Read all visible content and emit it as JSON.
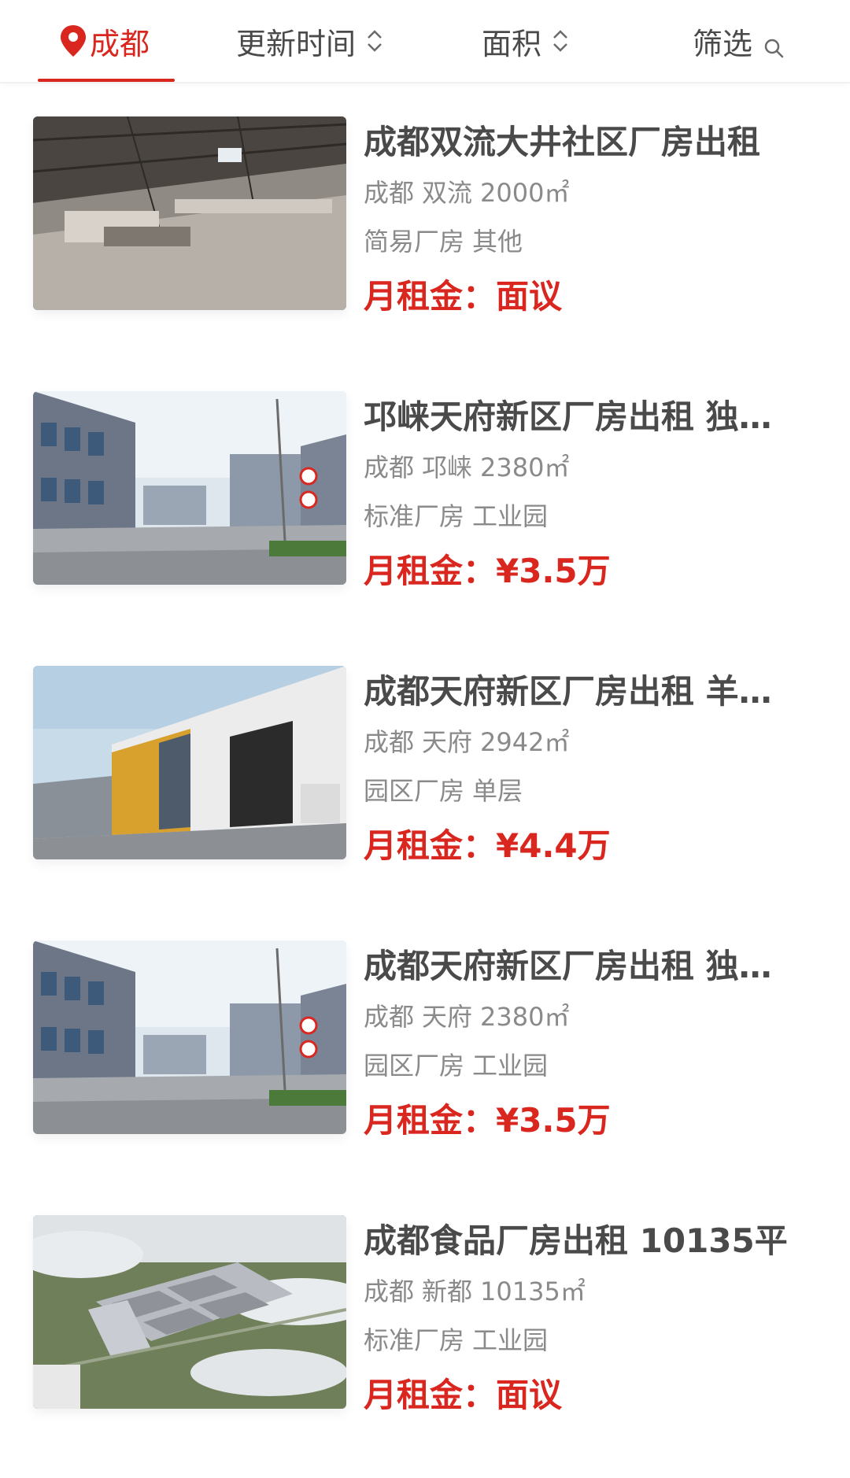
{
  "filter_bar": {
    "city": "成都",
    "update_time": "更新时间",
    "area": "面积",
    "filter": "筛选"
  },
  "listings": [
    {
      "title": "成都双流大井社区厂房出租",
      "city": "成都",
      "district": "双流",
      "area": "2000㎡",
      "type": "简易厂房",
      "category": "其他",
      "rent_label": "月租金：",
      "rent_value": "面议",
      "image": "warehouse-interior"
    },
    {
      "title": "邛崃天府新区厂房出租 独…",
      "city": "成都",
      "district": "邛崃",
      "area": "2380㎡",
      "type": "标准厂房",
      "category": "工业园",
      "rent_label": "月租金：",
      "rent_value": "¥3.5万",
      "image": "industrial-park-street"
    },
    {
      "title": "成都天府新区厂房出租 羊…",
      "city": "成都",
      "district": "天府",
      "area": "2942㎡",
      "type": "园区厂房",
      "category": "单层",
      "rent_label": "月租金：",
      "rent_value": "¥4.4万",
      "image": "factory-building-exterior"
    },
    {
      "title": "成都天府新区厂房出租 独…",
      "city": "成都",
      "district": "天府",
      "area": "2380㎡",
      "type": "园区厂房",
      "category": "工业园",
      "rent_label": "月租金：",
      "rent_value": "¥3.5万",
      "image": "industrial-park-street"
    },
    {
      "title": "成都食品厂房出租 10135平",
      "city": "成都",
      "district": "新都",
      "area": "10135㎡",
      "type": "标准厂房",
      "category": "工业园",
      "rent_label": "月租金：",
      "rent_value": "面议",
      "image": "aerial-rendering"
    }
  ],
  "colors": {
    "accent": "#d9271f",
    "title": "#4a4a4a",
    "meta": "#8a8a8a"
  }
}
